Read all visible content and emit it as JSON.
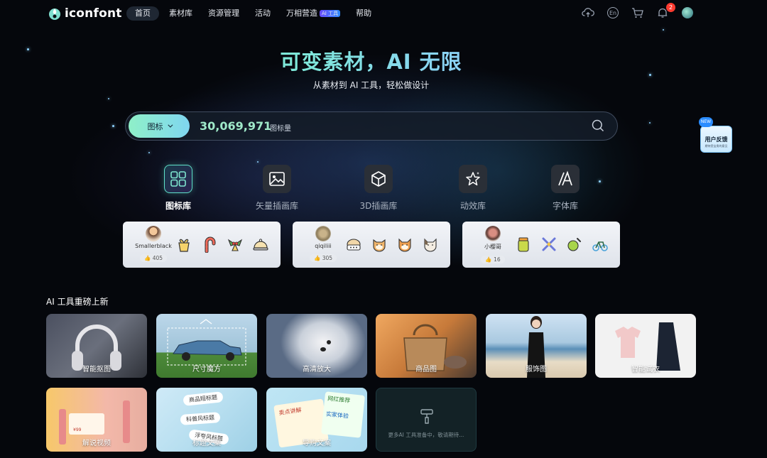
{
  "brand": {
    "name": "iconfont"
  },
  "nav": {
    "items": [
      {
        "label": "首页"
      },
      {
        "label": "素材库"
      },
      {
        "label": "资源管理"
      },
      {
        "label": "活动"
      },
      {
        "label": "万相营造",
        "badge": "AI 工具"
      },
      {
        "label": "帮助"
      }
    ],
    "lang_label": "En",
    "notification_count": "2"
  },
  "hero": {
    "title": "可变素材，AI 无限",
    "subtitle": "从素材到 AI 工具，轻松做设计"
  },
  "search": {
    "type_label": "图标",
    "count": "30,069,971",
    "count_unit": "图标量"
  },
  "feedback": {
    "title": "用户反馈",
    "subtitle": "期待您宝贵的意见",
    "badge": "NEW"
  },
  "categories": [
    {
      "label": "图标库",
      "icon": "grid-icon"
    },
    {
      "label": "矢量插画库",
      "icon": "image-icon"
    },
    {
      "label": "3D插画库",
      "icon": "cube-icon"
    },
    {
      "label": "动效库",
      "icon": "sparkle-star-icon"
    },
    {
      "label": "字体库",
      "icon": "font-a-icon"
    }
  ],
  "creators": [
    {
      "name": "Smallerblack",
      "likes": "405",
      "icons": [
        "gift-icon",
        "candy-cane-icon",
        "holly-icon",
        "cloche-icon"
      ]
    },
    {
      "name": "qiqiliii",
      "likes": "305",
      "icons": [
        "hamster-icon",
        "shiba-icon",
        "shiba-icon-2",
        "cat-icon"
      ]
    },
    {
      "name": "小樱哥",
      "likes": "16",
      "icons": [
        "jar-icon",
        "crossed-tools-icon",
        "ball-icon",
        "bike-icon"
      ]
    }
  ],
  "ai_section": {
    "heading": "AI 工具重磅上新",
    "tools": [
      {
        "label": "智能抠图"
      },
      {
        "label": "尺寸魔方"
      },
      {
        "label": "高清放大"
      },
      {
        "label": "商品图"
      },
      {
        "label": "服饰图"
      },
      {
        "label": "智能试衣"
      },
      {
        "label": "解说视频"
      },
      {
        "label": "标题文案"
      },
      {
        "label": "导购文案"
      }
    ],
    "placeholder_text": "更多AI 工具准备中，敬请期待..."
  },
  "tile_text": {
    "video_price": "¥99",
    "title_tags": [
      "商品短标题",
      "科普风标题",
      "浮夸风标题"
    ],
    "guide_tags": [
      "卖点讲解",
      "网红推荐",
      "实家体验"
    ]
  },
  "colors": {
    "accent_green": "#6ff0c0",
    "accent_blue": "#8fc8ff",
    "notification": "#ff3b30"
  }
}
